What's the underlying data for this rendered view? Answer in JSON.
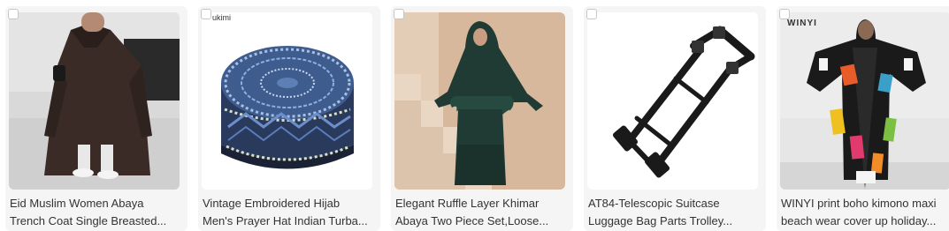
{
  "products": [
    {
      "image_icon": "abaya-trench-coat-photo",
      "title_line1": "Eid Muslim Women Abaya",
      "title_line2": "Trench Coat Single Breasted...",
      "brand": ""
    },
    {
      "image_icon": "embroidered-prayer-hat-photo",
      "title_line1": "Vintage Embroidered Hijab",
      "title_line2": "Men's Prayer Hat Indian Turba...",
      "brand": "ukimi"
    },
    {
      "image_icon": "ruffle-khimar-abaya-photo",
      "title_line1": "Elegant Ruffle Layer Khimar",
      "title_line2": "Abaya Two Piece Set,Loose...",
      "brand": ""
    },
    {
      "image_icon": "telescopic-suitcase-handle-photo",
      "title_line1": "AT84-Telescopic Suitcase",
      "title_line2": "Luggage Bag Parts Trolley...",
      "brand": ""
    },
    {
      "image_icon": "boho-kimono-photo",
      "title_line1": "WINYI print boho kimono maxi",
      "title_line2": "beach wear cover up holiday...",
      "brand": "WINYI"
    }
  ]
}
